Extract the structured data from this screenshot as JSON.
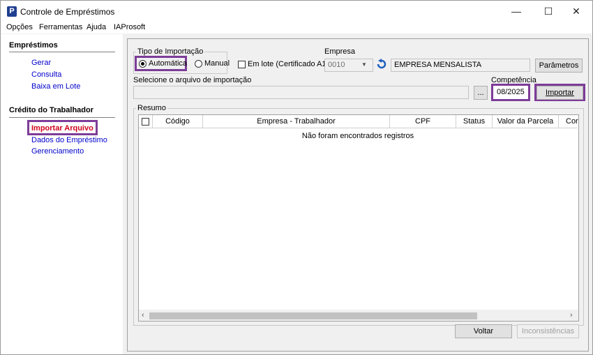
{
  "window": {
    "title": "Controle de Empréstimos",
    "icon_letter": "P",
    "minimize": "—",
    "maximize": "☐",
    "close": "✕"
  },
  "menu": [
    "Opções",
    "Ferramentas",
    "Ajuda",
    "IAProsoft"
  ],
  "sidebar": {
    "section1_title": "Empréstimos",
    "section1_items": [
      "Gerar",
      "Consulta",
      "Baixa em Lote"
    ],
    "section2_title": "Crédito do Trabalhador",
    "section2_items": [
      "Importar Arquivo",
      "Dados do Empréstimo",
      "Gerenciamento"
    ]
  },
  "import": {
    "type_legend": "Tipo de Importação",
    "opt_auto": "Automática",
    "opt_manual": "Manual",
    "batch_label": "Em lote (Certificado A1)",
    "empresa_label": "Empresa",
    "empresa_code": "0010",
    "empresa_name": "EMPRESA MENSALISTA",
    "params_button": "Parâmetros",
    "file_label": "Selecione o arquivo de importação",
    "file_value": "",
    "browse_button": "...",
    "competencia_label": "Competência",
    "competencia_value": "08/2025",
    "import_button": "Importar"
  },
  "resumo": {
    "legend": "Resumo",
    "columns": [
      "Código",
      "Empresa - Trabalhador",
      "CPF",
      "Status",
      "Valor da Parcela",
      "Cor"
    ],
    "empty_message": "Não foram encontrados registros"
  },
  "footer": {
    "back_button": "Voltar",
    "inconsistencies_button": "Inconsistências"
  },
  "colors": {
    "highlight": "#7d3c98",
    "link": "#0000cc",
    "active_link": "#d0021b"
  }
}
